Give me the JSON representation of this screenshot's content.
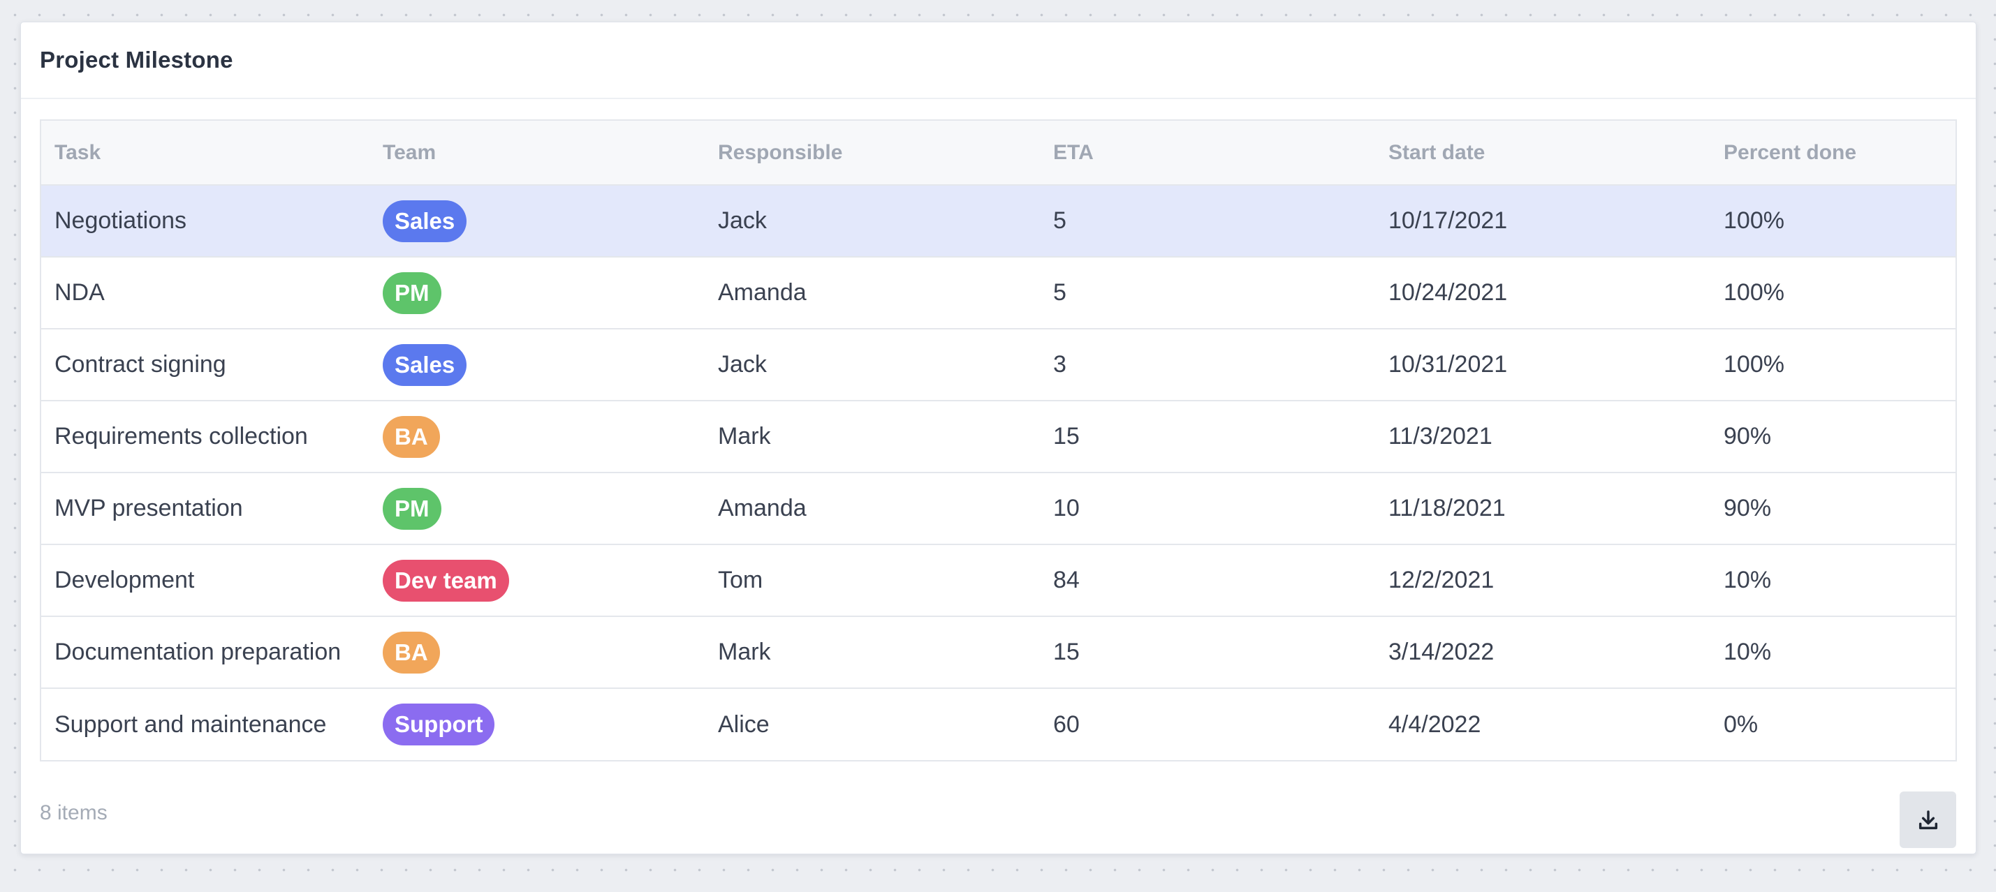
{
  "card": {
    "title": "Project Milestone"
  },
  "table": {
    "columns": [
      "Task",
      "Team",
      "Responsible",
      "ETA",
      "Start date",
      "Percent done"
    ],
    "rows": [
      {
        "task": "Negotiations",
        "team": "Sales",
        "team_color": "#5b79ee",
        "responsible": "Jack",
        "eta": "5",
        "start_date": "10/17/2021",
        "percent_done": "100%"
      },
      {
        "task": "NDA",
        "team": "PM",
        "team_color": "#5ec46a",
        "responsible": "Amanda",
        "eta": "5",
        "start_date": "10/24/2021",
        "percent_done": "100%"
      },
      {
        "task": "Contract signing",
        "team": "Sales",
        "team_color": "#5b79ee",
        "responsible": "Jack",
        "eta": "3",
        "start_date": "10/31/2021",
        "percent_done": "100%"
      },
      {
        "task": "Requirements collection",
        "team": "BA",
        "team_color": "#f1a65a",
        "responsible": "Mark",
        "eta": "15",
        "start_date": "11/3/2021",
        "percent_done": "90%"
      },
      {
        "task": "MVP presentation",
        "team": "PM",
        "team_color": "#5ec46a",
        "responsible": "Amanda",
        "eta": "10",
        "start_date": "11/18/2021",
        "percent_done": "90%"
      },
      {
        "task": "Development",
        "team": "Dev team",
        "team_color": "#e8506f",
        "responsible": "Tom",
        "eta": "84",
        "start_date": "12/2/2021",
        "percent_done": "10%"
      },
      {
        "task": "Documentation preparation",
        "team": "BA",
        "team_color": "#f1a65a",
        "responsible": "Mark",
        "eta": "15",
        "start_date": "3/14/2022",
        "percent_done": "10%"
      },
      {
        "task": "Support and maintenance",
        "team": "Support",
        "team_color": "#8b6cf0",
        "responsible": "Alice",
        "eta": "60",
        "start_date": "4/4/2022",
        "percent_done": "0%"
      }
    ],
    "selected_row": 0
  },
  "footer": {
    "items_count": "8 items",
    "download_icon": "download-icon"
  },
  "colors": {
    "selected_row_bg": "#e3e8fb",
    "header_bg": "#f7f8fa"
  }
}
